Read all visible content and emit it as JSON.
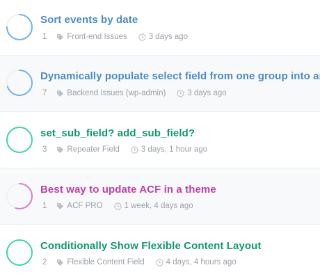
{
  "colors": {
    "blue": "#4a90d9",
    "green": "#12a67a",
    "pink": "#c44bb0",
    "meta": "#9aa2aa"
  },
  "topics": [
    {
      "title": "Sort events by date",
      "title_color": "#4a8bc8",
      "ring_color": "#6fb3e8",
      "ring_progress": 0.75,
      "count": "1",
      "category": "Front-end Issues",
      "time": "3 days ago"
    },
    {
      "title": "Dynamically populate select field from one group into ano",
      "title_color": "#4a8bc8",
      "ring_color": "#6fb3e8",
      "ring_progress": 0.7,
      "count": "7",
      "category": "Backend Issues (wp-admin)",
      "time": "3 days ago"
    },
    {
      "title": "set_sub_field? add_sub_field?",
      "title_color": "#0f9a6f",
      "ring_color": "#3fd3ae",
      "ring_progress": 1.0,
      "count": "3",
      "category": "Repeater Field",
      "time": "3 days, 1 hour ago"
    },
    {
      "title": "Best way to update ACF in a theme",
      "title_color": "#c040a8",
      "ring_color": "#d77ec8",
      "ring_progress": 0.55,
      "count": "1",
      "category": "ACF PRO",
      "time": "1 week, 4 days ago"
    },
    {
      "title": "Conditionally Show Flexible Content Layout",
      "title_color": "#0f9a6f",
      "ring_color": "#3fd3ae",
      "ring_progress": 1.0,
      "count": "2",
      "category": "Flexible Content Field",
      "time": "4 days, 4 hours ago"
    }
  ]
}
